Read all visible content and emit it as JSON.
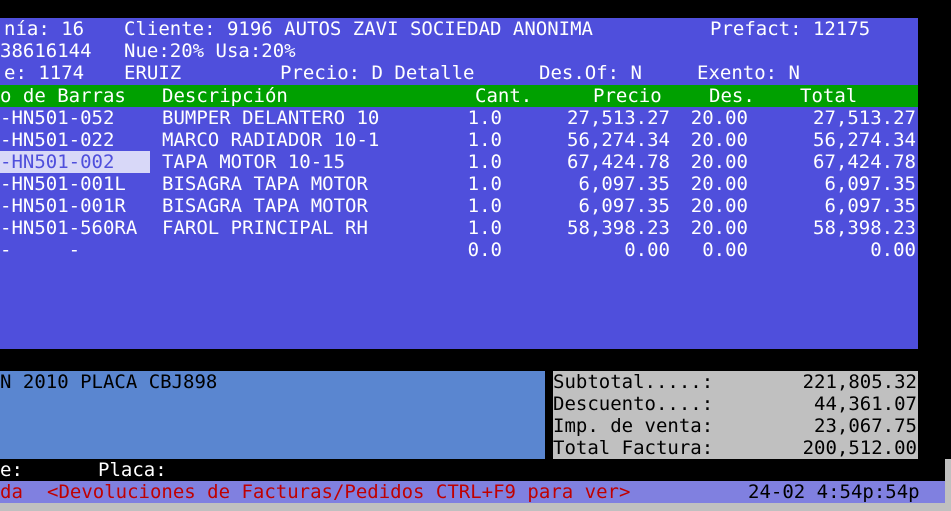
{
  "header": {
    "line1_left": "nía: 16",
    "cliente": "Cliente: 9196 AUTOS ZAVI SOCIEDAD ANONIMA",
    "prefact": "Prefact: 12175",
    "line2_left": "38616144",
    "nue_usa": "Nue:20% Usa:20%",
    "line3_left": "e: 1174",
    "user": "ERUIZ",
    "precio": "Precio: D Detalle",
    "desof": "Des.Of: N",
    "exento": "Exento: N"
  },
  "grid": {
    "columns": [
      "o de Barras",
      "Descripción",
      "Cant.",
      "Precio",
      "Des.",
      "Total"
    ],
    "rows": [
      {
        "barcode": "-HN501-052",
        "desc": "BUMPER DELANTERO 10",
        "cant": "1.0",
        "precio": "27,513.27",
        "des": "20.00",
        "total": "27,513.27"
      },
      {
        "barcode": "-HN501-022",
        "desc": "MARCO RADIADOR 10-1",
        "cant": "1.0",
        "precio": "56,274.34",
        "des": "20.00",
        "total": "56,274.34"
      },
      {
        "barcode": "-HN501-002",
        "desc": "TAPA MOTOR 10-15",
        "cant": "1.0",
        "precio": "67,424.78",
        "des": "20.00",
        "total": "67,424.78"
      },
      {
        "barcode": "-HN501-001L",
        "desc": "BISAGRA TAPA MOTOR",
        "cant": "1.0",
        "precio": "6,097.35",
        "des": "20.00",
        "total": "6,097.35"
      },
      {
        "barcode": "-HN501-001R",
        "desc": "BISAGRA TAPA MOTOR",
        "cant": "1.0",
        "precio": "6,097.35",
        "des": "20.00",
        "total": "6,097.35"
      },
      {
        "barcode": "-HN501-560RA",
        "desc": "FAROL PRINCIPAL RH",
        "cant": "1.0",
        "precio": "58,398.23",
        "des": "20.00",
        "total": "58,398.23"
      },
      {
        "barcode": "-     -",
        "desc": "",
        "cant": "0.0",
        "precio": "0.00",
        "des": "0.00",
        "total": "0.00"
      }
    ]
  },
  "notes": {
    "text": "N 2010 PLACA CBJ898"
  },
  "totals": {
    "subtotal_label": "Subtotal.....:",
    "subtotal_value": "221,805.32",
    "descuento_label": "Descuento....:",
    "descuento_value": "44,361.07",
    "imp_label": "Imp. de venta:",
    "imp_value": "23,067.75",
    "total_label": "Total Factura:",
    "total_value": "200,512.00"
  },
  "bottom": {
    "left": "e:",
    "placa": "Placa:"
  },
  "status": {
    "left": "da",
    "message": "<Devoluciones de Facturas/Pedidos CTRL+F9 para ver>",
    "datetime": "24-02 4:54p:54p"
  },
  "colors": {
    "main_bg": "#4f4fdc",
    "header_bar": "#00a000",
    "notes_bg": "#5a86d0",
    "totals_bg": "#c0c0c0",
    "status_text": "#c00000"
  }
}
